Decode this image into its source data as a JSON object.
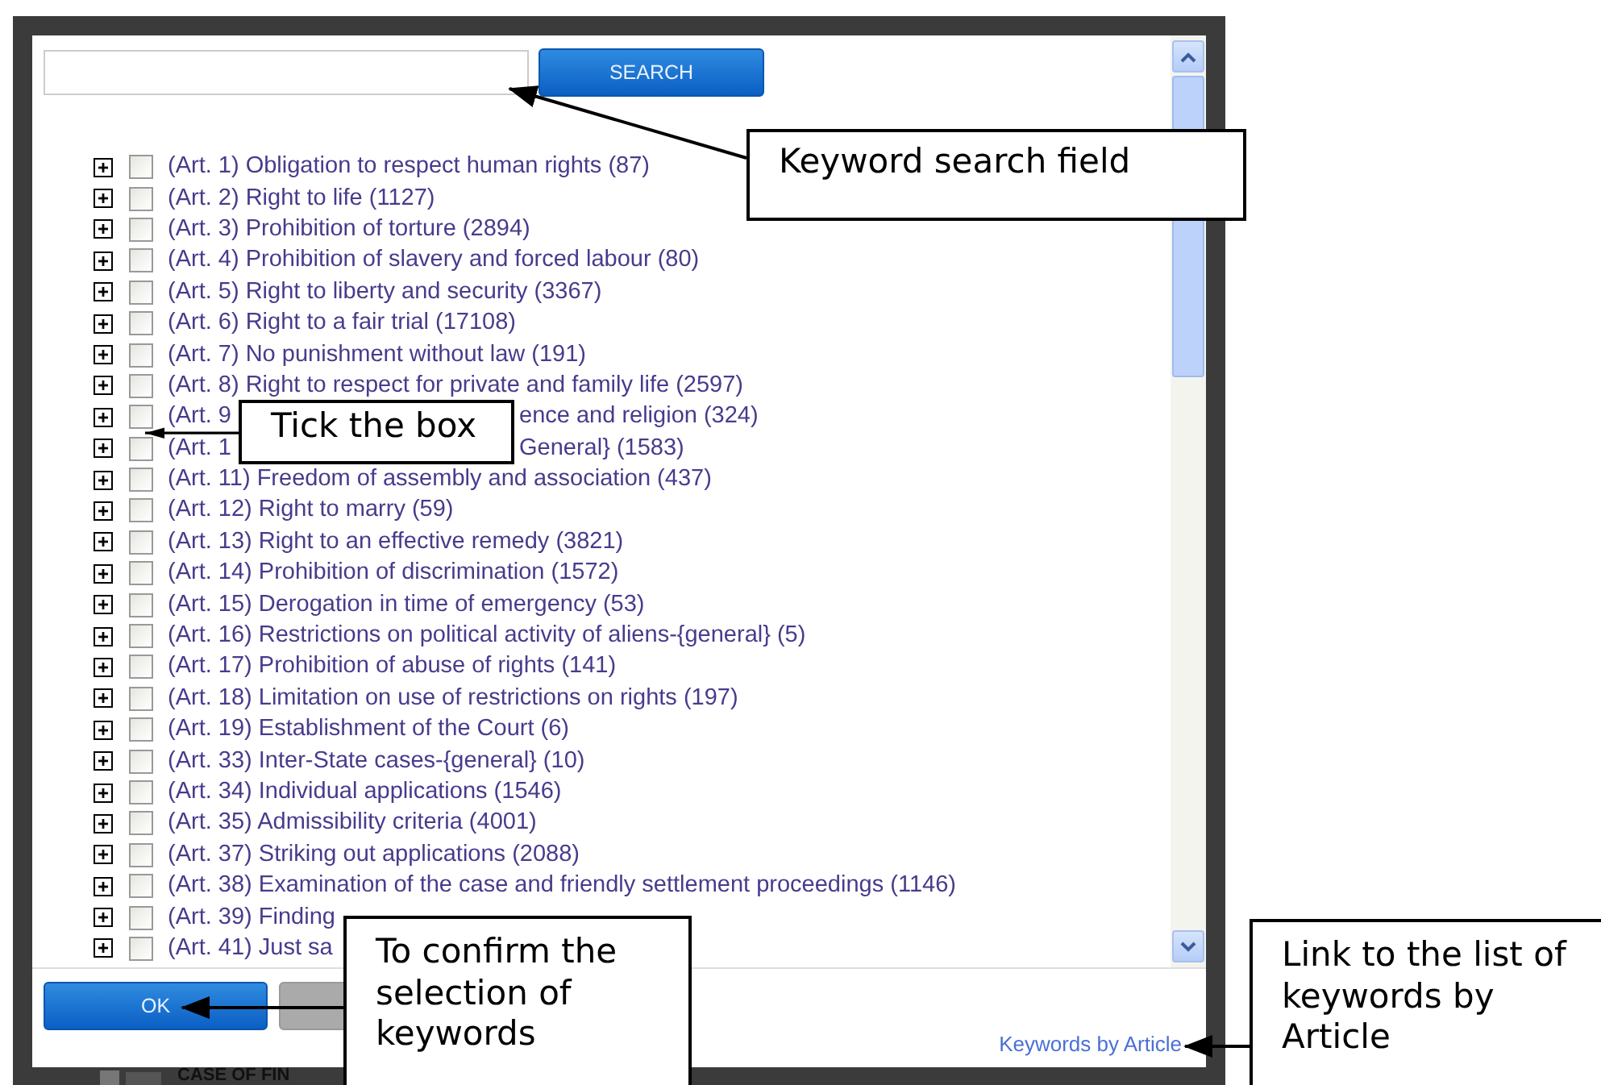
{
  "search": {
    "button": "SEARCH"
  },
  "keywords": [
    {
      "label": "(Art. 1) Obligation to respect human rights (87)",
      "expanded": false,
      "checked": false
    },
    {
      "label": "(Art. 2) Right to life (1127)",
      "expanded": false,
      "checked": false
    },
    {
      "label": "(Art. 3) Prohibition of torture (2894)",
      "expanded": false,
      "checked": false
    },
    {
      "label": "(Art. 4) Prohibition of slavery and forced labour (80)",
      "expanded": false,
      "checked": false
    },
    {
      "label": "(Art. 5) Right to liberty and security (3367)",
      "expanded": false,
      "checked": false
    },
    {
      "label": "(Art. 6) Right to a fair trial (17108)",
      "expanded": false,
      "checked": false
    },
    {
      "label": "(Art. 7) No punishment without law (191)",
      "expanded": false,
      "checked": false
    },
    {
      "label": "(Art. 8) Right to respect for private and family life (2597)",
      "expanded": false,
      "checked": false
    },
    {
      "label": "(Art. 9",
      "label_end": "ence and religion (324)",
      "expanded": false,
      "checked": false
    },
    {
      "label": "(Art. 1",
      "label_end": "General} (1583)",
      "expanded": false,
      "checked": false
    },
    {
      "label": "(Art. 11) Freedom of assembly and association (437)",
      "expanded": false,
      "checked": false
    },
    {
      "label": "(Art. 12) Right to marry (59)",
      "expanded": false,
      "checked": false
    },
    {
      "label": "(Art. 13) Right to an effective remedy (3821)",
      "expanded": false,
      "checked": false
    },
    {
      "label": "(Art. 14) Prohibition of discrimination (1572)",
      "expanded": false,
      "checked": false
    },
    {
      "label": "(Art. 15) Derogation in time of emergency (53)",
      "expanded": false,
      "checked": false
    },
    {
      "label": "(Art. 16) Restrictions on political activity of aliens-{general} (5)",
      "expanded": false,
      "checked": false
    },
    {
      "label": "(Art. 17) Prohibition of abuse of rights (141)",
      "expanded": false,
      "checked": false
    },
    {
      "label": "(Art. 18) Limitation on use of restrictions on rights (197)",
      "expanded": false,
      "checked": false
    },
    {
      "label": "(Art. 19) Establishment of the Court (6)",
      "expanded": false,
      "checked": false
    },
    {
      "label": "(Art. 33) Inter-State cases-{general} (10)",
      "expanded": false,
      "checked": false
    },
    {
      "label": "(Art. 34) Individual applications (1546)",
      "expanded": false,
      "checked": false
    },
    {
      "label": "(Art. 35) Admissibility criteria (4001)",
      "expanded": false,
      "checked": false
    },
    {
      "label": "(Art. 37) Striking out applications (2088)",
      "expanded": false,
      "checked": false
    },
    {
      "label": "(Art. 38) Examination of the case and friendly settlement proceedings (1146)",
      "expanded": false,
      "checked": false
    },
    {
      "label": "(Art. 39) Finding",
      "expanded": false,
      "checked": false
    },
    {
      "label": "(Art. 41) Just sa",
      "expanded": false,
      "checked": false
    }
  ],
  "footer": {
    "ok_button": "OK",
    "link": "Keywords by Article"
  },
  "background_page": {
    "title": "CASE OF FIN"
  },
  "callouts": [
    {
      "text": "Keyword search field"
    },
    {
      "text": "Tick the box"
    },
    {
      "text": "To confirm the selection of keywords"
    },
    {
      "text": "Link to the list of keywords by Article"
    }
  ]
}
